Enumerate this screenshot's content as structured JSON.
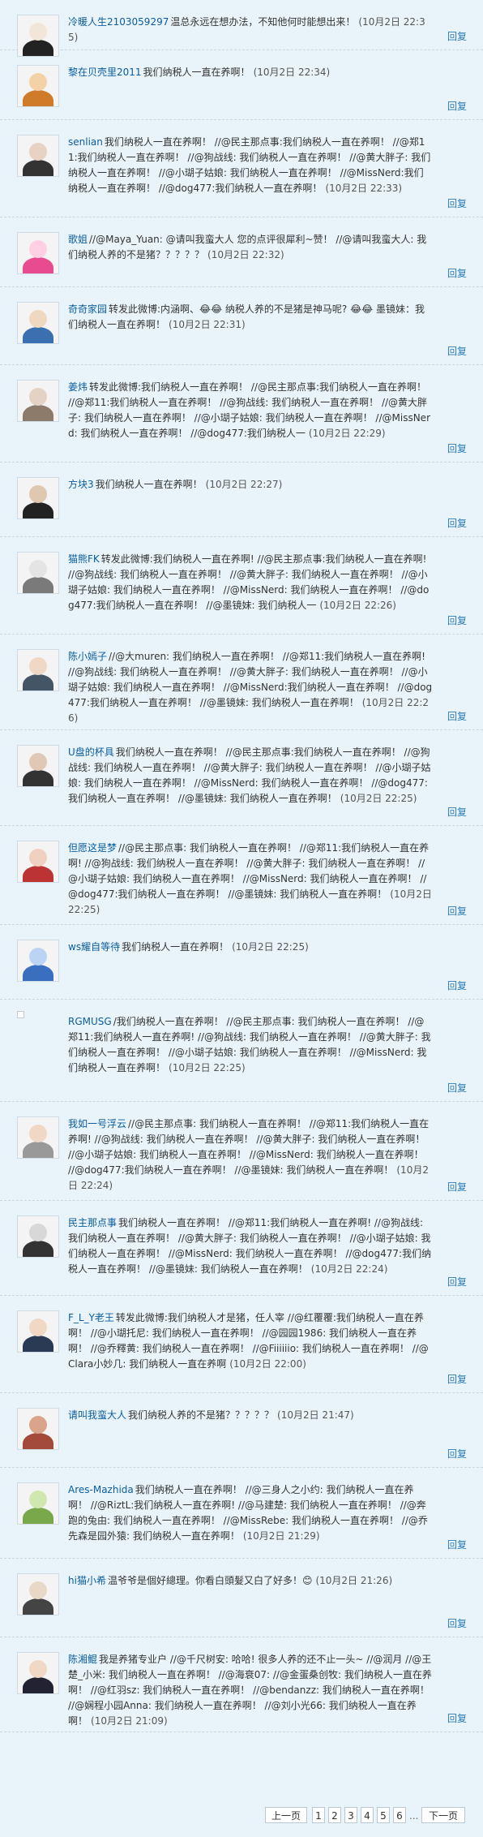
{
  "reply_label": "回复",
  "comments": [
    {
      "author": "冷暖人生2103059297",
      "text": "温总永远在想办法，不知他何时能想出来！",
      "time": "(10月2日 22:35)"
    },
    {
      "author": "黎在贝壳里2011",
      "text": "我们纳税人一直在养啊！",
      "time": "(10月2日 22:34)"
    },
    {
      "author": "senlian",
      "text": "我们纳税人一直在养啊！ //@民主那点事:我们纳税人一直在养啊！ //@郑11:我们纳税人一直在养啊！ //@狗战线: 我们纳税人一直在养啊！ //@黄大胖子: 我们纳税人一直在养啊！ //@小瑚子姑娘: 我们纳税人一直在养啊！ //@MissNerd:我们纳税人一直在养啊！ //@dog477:我们纳税人一直在养啊！",
      "time": "(10月2日 22:33)"
    },
    {
      "author": "歌姐",
      "text": "//@Maya_Yuan: @请叫我蛮大人 您的点评很犀利~赞！ //@请叫我蛮大人: 我们纳税人养的不是猪？？？？？",
      "time": "(10月2日 22:32)"
    },
    {
      "author": "奇奇家园",
      "text": "转发此微博:内涵啊、😂😂 纳税人养的不是猪是神马呢? 😂😂 墨镜妹：我们纳税人一直在养啊！",
      "time": "(10月2日 22:31)"
    },
    {
      "author": "姜炜",
      "text": "转发此微博:我们纳税人一直在养啊！ //@民主那点事:我们纳税人一直在养啊！ //@郑11:我们纳税人一直在养啊！ //@狗战线: 我们纳税人一直在养啊！ //@黄大胖子: 我们纳税人一直在养啊！ //@小瑚子姑娘: 我们纳税人一直在养啊！ //@MissNerd: 我们纳税人一直在养啊！ //@dog477:我们纳税人一",
      "time": "(10月2日 22:29)"
    },
    {
      "author": "方块3",
      "text": "我们纳税人一直在养啊！",
      "time": "(10月2日 22:27)"
    },
    {
      "author": "猫熊FK",
      "text": "转发此微博:我们纳税人一直在养啊! //@民主那点事:我们纳税人一直在养啊! //@狗战线: 我们纳税人一直在养啊！ //@黄大胖子: 我们纳税人一直在养啊！ //@小瑚子姑娘: 我们纳税人一直在养啊！ //@MissNerd: 我们纳税人一直在养啊！ //@dog477:我们纳税人一直在养啊！ //@墨镜妹: 我们纳税人一",
      "time": "(10月2日 22:26)"
    },
    {
      "author": "陈小嫣子",
      "text": "//@大muren: 我们纳税人一直在养啊！ //@郑11:我们纳税人一直在养啊! //@狗战线: 我们纳税人一直在养啊！ //@黄大胖子: 我们纳税人一直在养啊！ //@小瑚子姑娘: 我们纳税人一直在养啊！ //@MissNerd:我们纳税人一直在养啊！ //@dog477:我们纳税人一直在养啊！ //@墨镜妹: 我们纳税人一直在养啊！",
      "time": "(10月2日 22:26)"
    },
    {
      "author": "U盘的杯具",
      "text": "我们纳税人一直在养啊！ //@民主那点事:我们纳税人一直在养啊！ //@狗战线: 我们纳税人一直在养啊！ //@黄大胖子: 我们纳税人一直在养啊！ //@小瑚子姑娘: 我们纳税人一直在养啊！ //@MissNerd: 我们纳税人一直在养啊！ //@dog477:我们纳税人一直在养啊！ //@墨镜妹: 我们纳税人一直在养啊！",
      "time": "(10月2日 22:25)"
    },
    {
      "author": "但愿这是梦",
      "text": "//@民主那点事: 我们纳税人一直在养啊！ //@郑11:我们纳税人一直在养啊! //@狗战线: 我们纳税人一直在养啊！ //@黄大胖子: 我们纳税人一直在养啊！ //@小瑚子姑娘: 我们纳税人一直在养啊！ //@MissNerd: 我们纳税人一直在养啊！ //@dog477:我们纳税人一直在养啊！ //@墨镜妹: 我们纳税人一直在养啊！",
      "time": "(10月2日 22:25)"
    },
    {
      "author": "ws耀自等待",
      "text": "我们纳税人一直在养啊！",
      "time": "(10月2日 22:25)"
    },
    {
      "author": "RGMUSG",
      "text": "/我们纳税人一直在养啊！ //@民主那点事: 我们纳税人一直在养啊！ //@郑11:我们纳税人一直在养啊! //@狗战线: 我们纳税人一直在养啊！ //@黄大胖子: 我们纳税人一直在养啊！ //@小瑚子姑娘: 我们纳税人一直在养啊！ //@MissNerd: 我们纳税人一直在养啊！",
      "time": "(10月2日 22:25)"
    },
    {
      "author": "我如一号浮云",
      "text": "//@民主那点事: 我们纳税人一直在养啊！ //@郑11:我们纳税人一直在养啊! //@狗战线: 我们纳税人一直在养啊！ //@黄大胖子: 我们纳税人一直在养啊！ //@小瑚子姑娘: 我们纳税人一直在养啊！ //@MissNerd: 我们纳税人一直在养啊！ //@dog477:我们纳税人一直在养啊！ //@墨镜妹: 我们纳税人一直在养啊！",
      "time": "(10月2日 22:24)"
    },
    {
      "author": "民主那点事",
      "text": "我们纳税人一直在养啊！ //@郑11:我们纳税人一直在养啊! //@狗战线: 我们纳税人一直在养啊！ //@黄大胖子: 我们纳税人一直在养啊！ //@小瑚子姑娘: 我们纳税人一直在养啊！ //@MissNerd: 我们纳税人一直在养啊！ //@dog477:我们纳税人一直在养啊！ //@墨镜妹: 我们纳税人一直在养啊！",
      "time": "(10月2日 22:24)"
    },
    {
      "author": "F_L_Y老王",
      "text": "转发此微博:我们纳税人才是猪，任人宰 //@红覆覆:我们纳税人一直在养啊！ //@小瑚托尼: 我们纳税人一直在养啊！ //@园园1986: 我们纳税人一直在养啊！ //@乔釋黄: 我们纳税人一直在养啊！ //@Fiiiiiio: 我们纳税人一直在养啊！ //@Clara小妙几: 我们纳税人一直在养啊",
      "time": "(10月2日 22:00)"
    },
    {
      "author": "请叫我蛮大人",
      "text": "我们纳税人养的不是猪？？？？？",
      "time": "(10月2日 21:47)"
    },
    {
      "author": "Ares-Mazhida",
      "text": "我们纳税人一直在养啊！ //@三身人之小约: 我们纳税人一直在养啊！ //@RiztL:我们纳税人一直在养啊! //@马建楚: 我们纳税人一直在养啊！ //@奔跑的兔由: 我们纳税人一直在养啊！ //@MissRebe: 我们纳税人一直在养啊！ //@乔先森是园外猿: 我们纳税人一直在养啊！",
      "time": "(10月2日 21:29)"
    },
    {
      "author": "hi猫小希",
      "text": "温爷爷是個好總理。你看白頭髮又白了好多！😊",
      "time": "(10月2日 21:26)"
    },
    {
      "author": "陈湘鲲",
      "text": "我是养猪专业户 //@千尺树安: 哈哈! 很多人养的还不止一头~ //@润月 //@王楚_小米: 我们纳税人一直在养啊！ //@海衰07: //@金蛋桑创牧: 我们纳税人一直在养啊！ //@红羽sz: 我们纳税人一直在养啊！ //@bendanzz: 我们纳税人一直在养啊！ //@娴程小园Anna: 我们纳税人一直在养啊！ //@刘小光66: 我们纳税人一直在养啊！",
      "time": "(10月2日 21:09)"
    }
  ],
  "pagination": {
    "prev": "上一页",
    "pages": [
      "1",
      "2",
      "3",
      "4",
      "5",
      "6"
    ],
    "ellipsis": "...",
    "next": "下一页"
  }
}
